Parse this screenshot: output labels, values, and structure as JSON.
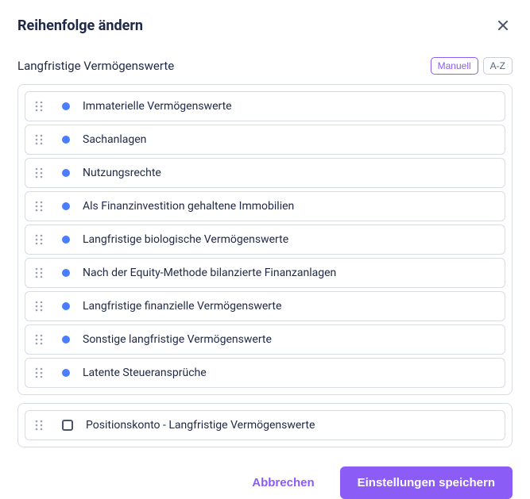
{
  "header": {
    "title": "Reihenfolge ändern"
  },
  "section": {
    "label": "Langfristige Vermögenswerte",
    "sort_manual": "Manuell",
    "sort_az": "A-Z"
  },
  "items": [
    {
      "label": "Immaterielle Vermögenswerte"
    },
    {
      "label": "Sachanlagen"
    },
    {
      "label": "Nutzungsrechte"
    },
    {
      "label": "Als Finanzinvestition gehaltene Immobilien"
    },
    {
      "label": "Langfristige biologische Vermögenswerte"
    },
    {
      "label": "Nach der Equity-Methode bilanzierte Finanzanlagen"
    },
    {
      "label": "Langfristige finanzielle Vermögenswerte"
    },
    {
      "label": "Sonstige langfristige Vermögenswerte"
    },
    {
      "label": "Latente Steueransprüche"
    }
  ],
  "position_item": {
    "label": "Positionskonto - Langfristige Vermögenswerte"
  },
  "footer": {
    "cancel": "Abbrechen",
    "save": "Einstellungen speichern"
  }
}
